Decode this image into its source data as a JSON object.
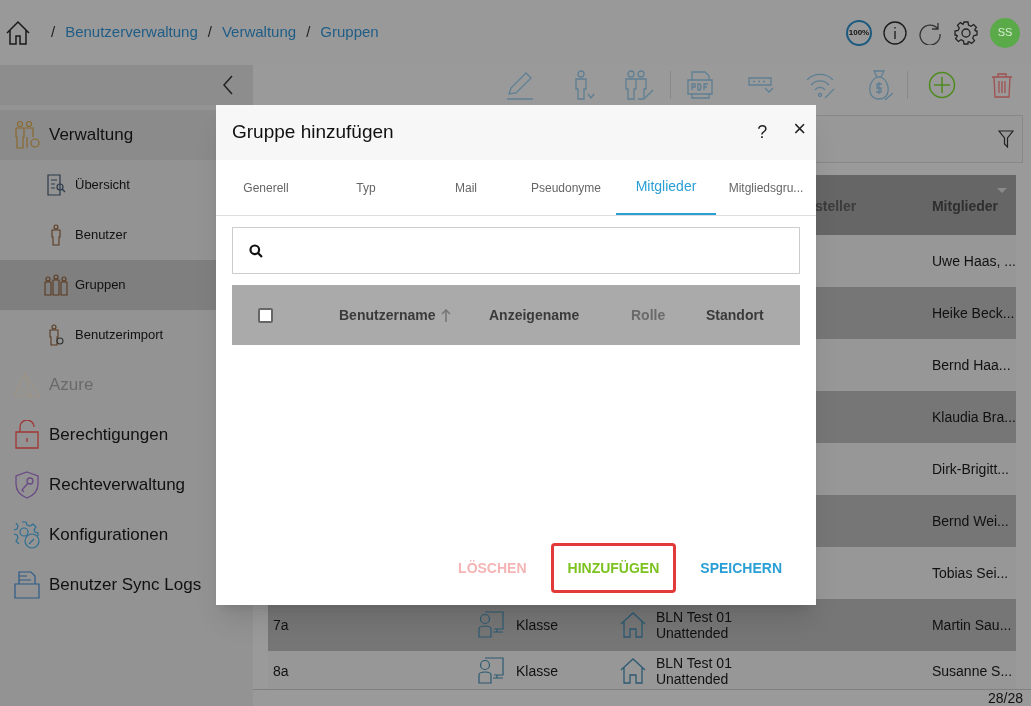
{
  "header": {
    "breadcrumb": [
      {
        "separator": "/",
        "label": "Benutzerverwaltung"
      },
      {
        "separator": "/",
        "label": "Verwaltung"
      },
      {
        "separator": "/",
        "label": "Gruppen"
      }
    ],
    "zoom_badge": "100%",
    "avatar": "SS"
  },
  "sidebar": {
    "items": [
      {
        "label": "Verwaltung",
        "expanded": true,
        "disabled": false,
        "children": [
          {
            "label": "Übersicht",
            "selected": false
          },
          {
            "label": "Benutzer",
            "selected": false
          },
          {
            "label": "Gruppen",
            "selected": true
          },
          {
            "label": "Benutzerimport",
            "selected": false
          }
        ]
      },
      {
        "label": "Azure",
        "expanded": false,
        "disabled": true
      },
      {
        "label": "Berechtigungen",
        "expanded": false,
        "disabled": false
      },
      {
        "label": "Rechteverwaltung",
        "expanded": false,
        "disabled": false
      },
      {
        "label": "Konfigurationen",
        "expanded": false,
        "disabled": false
      },
      {
        "label": "Benutzer Sync Logs",
        "expanded": false,
        "disabled": false
      }
    ]
  },
  "table": {
    "columns": [
      "steller",
      "Mitglieder"
    ],
    "rows": [
      {
        "members": "Uwe Haas, ..."
      },
      {
        "members": "Heike Beck..."
      },
      {
        "members": "Bernd Haa..."
      },
      {
        "members": "Klaudia Bra..."
      },
      {
        "members": "Dirk-Brigitt..."
      },
      {
        "members": "Bernd Wei..."
      },
      {
        "members": "Tobias Sei..."
      },
      {
        "name": "7a",
        "type": "Klasse",
        "location": "BLN Test 01 Unattended",
        "members": "Martin Sau..."
      },
      {
        "name": "8a",
        "type": "Klasse",
        "location": "BLN Test 01 Unattended",
        "members": "Susanne S..."
      }
    ],
    "count": "28/28"
  },
  "dialog": {
    "title": "Gruppe hinzufügen",
    "help": "?",
    "close": "×",
    "tabs": [
      {
        "label": "Generell",
        "selected": false
      },
      {
        "label": "Typ",
        "selected": false
      },
      {
        "label": "Mail",
        "selected": false
      },
      {
        "label": "Pseudonyme",
        "selected": false
      },
      {
        "label": "Mitglieder",
        "selected": true
      },
      {
        "label": "Mitgliedsgru...",
        "selected": false
      }
    ],
    "select_all": {
      "checked": false
    },
    "columns": [
      {
        "label": "Benutzername",
        "sorted": true,
        "disabled": false
      },
      {
        "label": "Anzeigename",
        "sorted": false,
        "disabled": false
      },
      {
        "label": "Rolle",
        "sorted": false,
        "disabled": true
      },
      {
        "label": "Standort",
        "sorted": false,
        "disabled": false
      }
    ],
    "buttons": [
      {
        "label": "LÖSCHEN",
        "kind": "delete",
        "disabled": true,
        "highlighted": false
      },
      {
        "label": "HINZUFÜGEN",
        "kind": "add",
        "disabled": false,
        "highlighted": true
      },
      {
        "label": "SPEICHERN",
        "kind": "save",
        "disabled": false,
        "highlighted": false
      }
    ]
  }
}
